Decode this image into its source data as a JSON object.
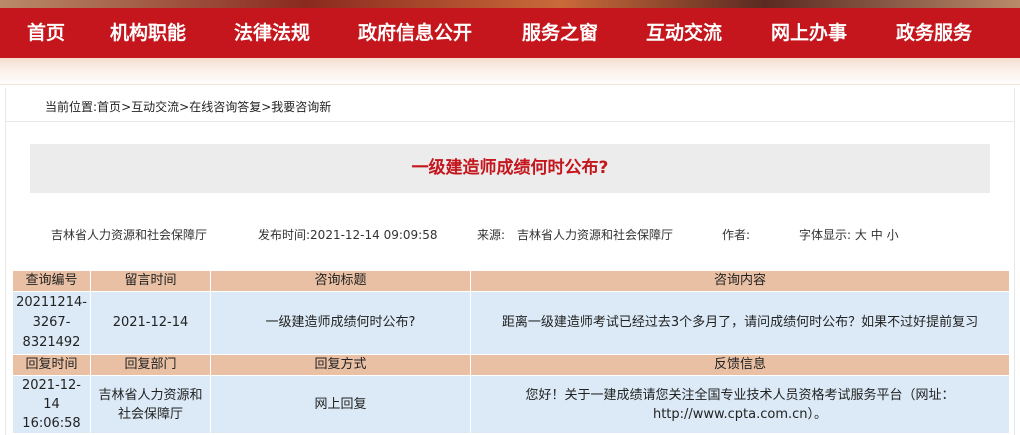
{
  "nav": {
    "items": [
      "首页",
      "机构职能",
      "法律法规",
      "政府信息公开",
      "服务之窗",
      "互动交流",
      "网上办事",
      "政务服务"
    ]
  },
  "breadcrumb": {
    "prefix": "当前位置:",
    "items": [
      "首页",
      "互动交流",
      "在线咨询答复",
      "我要咨询新"
    ],
    "separator": ">"
  },
  "article": {
    "title": "一级建造师成绩何时公布?",
    "org": "吉林省人力资源和社会保障厅",
    "publish_time": "发布时间:2021-12-14 09:09:58",
    "source_label": "来源:",
    "source": "吉林省人力资源和社会保障厅",
    "author_label": "作者:",
    "fontsize_label": "字体显示:",
    "fontsize_large": "大",
    "fontsize_medium": "中",
    "fontsize_small": "小"
  },
  "consult": {
    "headers": [
      "查询编号",
      "留言时间",
      "咨询标题",
      "咨询内容"
    ],
    "id": "20211214-3267-8321492",
    "time": "2021-12-14",
    "title": "一级建造师成绩何时公布?",
    "content": "距离一级建造师考试已经过去3个多月了，请问成绩何时公布？如果不过好提前复习"
  },
  "reply": {
    "headers": [
      "回复时间",
      "回复部门",
      "回复方式",
      "反馈信息"
    ],
    "time": "2021-12-14 16:06:58",
    "dept": "吉林省人力资源和社会保障厅",
    "method": "网上回复",
    "feedback": "您好！关于一建成绩请您关注全国专业技术人员资格考试服务平台（网址：http://www.cpta.com.cn）。"
  },
  "colors": {
    "nav_bg": "#c4161c",
    "title_color": "#c4161c",
    "header_row_bg": "#e9c0a4",
    "data_row_bg": "#dbeaf6"
  }
}
